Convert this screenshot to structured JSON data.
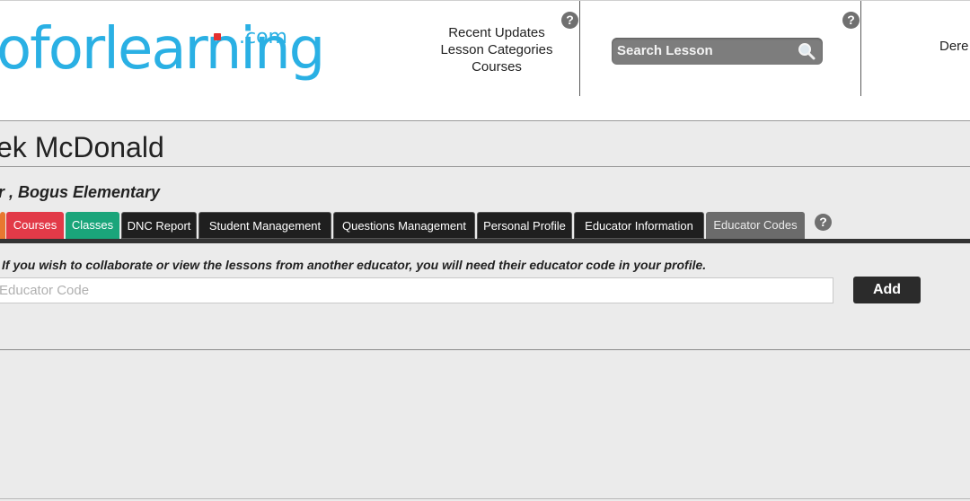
{
  "brand": {
    "logo_text": "oforlearning",
    "logo_suffix": ".com"
  },
  "header": {
    "nav_links": [
      "Recent Updates",
      "Lesson Categories",
      "Courses"
    ],
    "search": {
      "placeholder": "Search Lesson"
    },
    "user_name_truncated": "Dere",
    "help_glyph": "?"
  },
  "profile": {
    "name": "ek McDonald",
    "role_school": "r , Bogus Elementary"
  },
  "tabs": [
    {
      "label": "",
      "color": "#e87830"
    },
    {
      "label": "Courses",
      "color": "#e23a48"
    },
    {
      "label": "Classes",
      "color": "#1aa57a"
    },
    {
      "label": "DNC Report"
    },
    {
      "label": "Student Management"
    },
    {
      "label": "Questions Management"
    },
    {
      "label": "Personal Profile"
    },
    {
      "label": "Educator Information"
    },
    {
      "label": "Educator Codes",
      "active": true
    }
  ],
  "educator_codes": {
    "info_text": "If you wish to collaborate or view the lessons from another educator, you will need their educator code in your profile.",
    "input_placeholder": "Educator Code",
    "add_label": "Add"
  },
  "icons": [
    "search-icon",
    "help-icon"
  ]
}
